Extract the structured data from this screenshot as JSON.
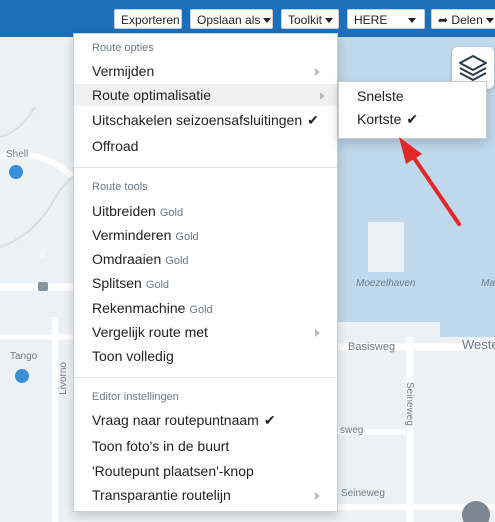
{
  "toolbar": {
    "export_label": "Exporteren",
    "save_label": "Opslaan als",
    "toolkit_label": "Toolkit",
    "provider_label": "HERE",
    "share_label": "Delen"
  },
  "map": {
    "labels": {
      "shell": "Shell",
      "tango": "Tango",
      "livorno": "Livorno",
      "road3": "3",
      "moezelhaven": "Moezelhaven",
      "basisweg": "Basisweg",
      "westerhaven": "Weste",
      "seineweg_v": "Seineweg",
      "seineweg_h": "Seineweg",
      "sweg": "sweg",
      "ma": "Ma"
    }
  },
  "menu": {
    "section_route_options": "Route opties",
    "avoid": "Vermijden",
    "optimize": "Route optimalisatie",
    "seasonal": "Uitschakelen seizoensafsluitingen",
    "offroad": "Offroad",
    "section_route_tools": "Route tools",
    "expand": "Uitbreiden",
    "reduce": "Verminderen",
    "reverse": "Omdraaien",
    "split": "Splitsen",
    "calculator": "Rekenmachine",
    "compare": "Vergelijk route met",
    "show_full": "Toon volledig",
    "section_editor": "Editor instellingen",
    "ask_name": "Vraag naar routepuntnaam",
    "show_photos": "Toon foto's in de buurt",
    "place_btn": "'Routepunt plaatsen'-knop",
    "transparency": "Transparantie routelijn",
    "gold": "Gold",
    "check": "✔"
  },
  "submenu": {
    "fastest": "Snelste",
    "shortest": "Kortste",
    "check": "✔"
  }
}
